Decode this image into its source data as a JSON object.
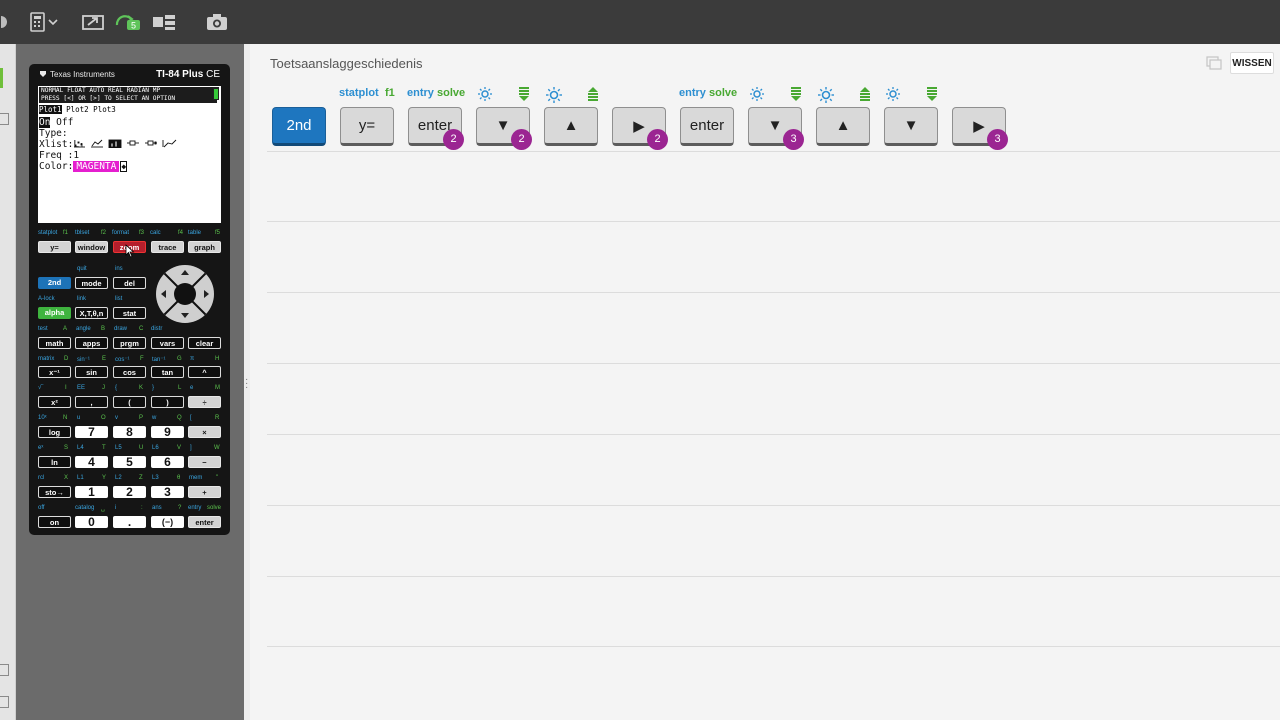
{
  "toolbar": {
    "icons": [
      "calculator-menu-icon",
      "send-to-calculator-icon",
      "connect-calculator-icon",
      "layout-icon",
      "screenshot-icon"
    ],
    "connect_badge": "5"
  },
  "calculator": {
    "brand": "Texas Instruments",
    "model": "TI-84 Plus",
    "model_suffix": "CE",
    "screen": {
      "header1": "NORMAL FLOAT AUTO REAL RADIAN MP",
      "header2": "PRESS [<] OR [>] TO SELECT AN OPTION",
      "plots_selected": "Plot1",
      "plots_rest": " Plot2 Plot3",
      "on": "On",
      "off": " Off",
      "type_label": "Type:",
      "xlist": "Xlist:L₁",
      "freq": "Freq :1",
      "color_label": "Color:",
      "color_value": "MAGENTA"
    },
    "top_row_subs": [
      "statplot",
      "f1",
      "tblset",
      "f2",
      "format",
      "f3",
      "calc",
      "f4",
      "table",
      "f5"
    ],
    "keys": {
      "y": "y=",
      "window": "window",
      "zoom": "zoom",
      "trace": "trace",
      "graph": "graph",
      "second": "2nd",
      "mode": "mode",
      "del": "del",
      "alpha": "alpha",
      "xtn": "X,T,θ,n",
      "stat": "stat",
      "math": "math",
      "apps": "apps",
      "prgm": "prgm",
      "vars": "vars",
      "clear": "clear",
      "xinv": "x⁻¹",
      "sin": "sin",
      "cos": "cos",
      "tan": "tan",
      "pow": "^",
      "xsq": "x²",
      "comma": ",",
      "lparen": "(",
      "rparen": ")",
      "div": "÷",
      "log": "log",
      "n7": "7",
      "n8": "8",
      "n9": "9",
      "mul": "×",
      "ln": "ln",
      "n4": "4",
      "n5": "5",
      "n6": "6",
      "minus": "−",
      "sto": "sto→",
      "n1": "1",
      "n2": "2",
      "n3": "3",
      "plus": "+",
      "on": "on",
      "n0": "0",
      "dot": ".",
      "neg": "(−)",
      "enter": "enter"
    },
    "subs": {
      "quit": "quit",
      "ins": "ins",
      "alock": "A-lock",
      "link": "link",
      "list": "list",
      "test": "test",
      "A": "A",
      "angle": "angle",
      "B": "B",
      "draw": "draw",
      "C": "C",
      "distr": "distr",
      "matrix": "matrix",
      "D": "D",
      "sininv": "sin⁻¹",
      "E": "E",
      "cosinv": "cos⁻¹",
      "F": "F",
      "taninv": "tan⁻¹",
      "G": "G",
      "pi": "π",
      "H": "H",
      "sqrt": "√‾",
      "I": "I",
      "EE": "EE",
      "J": "J",
      "lbrace": "{",
      "K": "K",
      "rbrace": "}",
      "L": "L",
      "e": "e",
      "M": "M",
      "tenx": "10ˣ",
      "N": "N",
      "u": "u",
      "O": "O",
      "v": "v",
      "P": "P",
      "w": "w",
      "Q": "Q",
      "lbrack": "[",
      "R": "R",
      "ex": "eˣ",
      "S": "S",
      "L4": "L4",
      "T": "T",
      "L5": "L5",
      "U": "U",
      "L6": "L6",
      "V": "V",
      "rbrack": "]",
      "W": "W",
      "rcl": "rcl",
      "X": "X",
      "L1": "L1",
      "Y": "Y",
      "L2": "L2",
      "Z": "Z",
      "L3": "L3",
      "theta": "θ",
      "mem": "mem",
      "quote": "\"",
      "off": "off",
      "catalog": "catalog",
      "space": "␣",
      "i": "i",
      "colon": ":",
      "ans": "ans",
      "q": "?",
      "entry": "entry",
      "solve": "solve"
    }
  },
  "history": {
    "title": "Toetsaanslaggeschiedenis",
    "clear_label": "WISSEN",
    "keys": [
      {
        "label": "2nd",
        "style": "blue"
      },
      {
        "label": "y=",
        "top_blue": "statplot",
        "top_green": "f1"
      },
      {
        "label": "enter",
        "top_blue": "entry",
        "top_green": "solve",
        "badge": "2"
      },
      {
        "label": "▼",
        "badge": "2"
      },
      {
        "label": "▲"
      },
      {
        "label": "▶",
        "badge": "2"
      },
      {
        "label": "enter",
        "top_blue": "entry",
        "top_green": "solve"
      },
      {
        "label": "▼",
        "badge": "3"
      },
      {
        "label": "▲"
      },
      {
        "label": "▼"
      },
      {
        "label": "▶",
        "badge": "3"
      }
    ]
  }
}
